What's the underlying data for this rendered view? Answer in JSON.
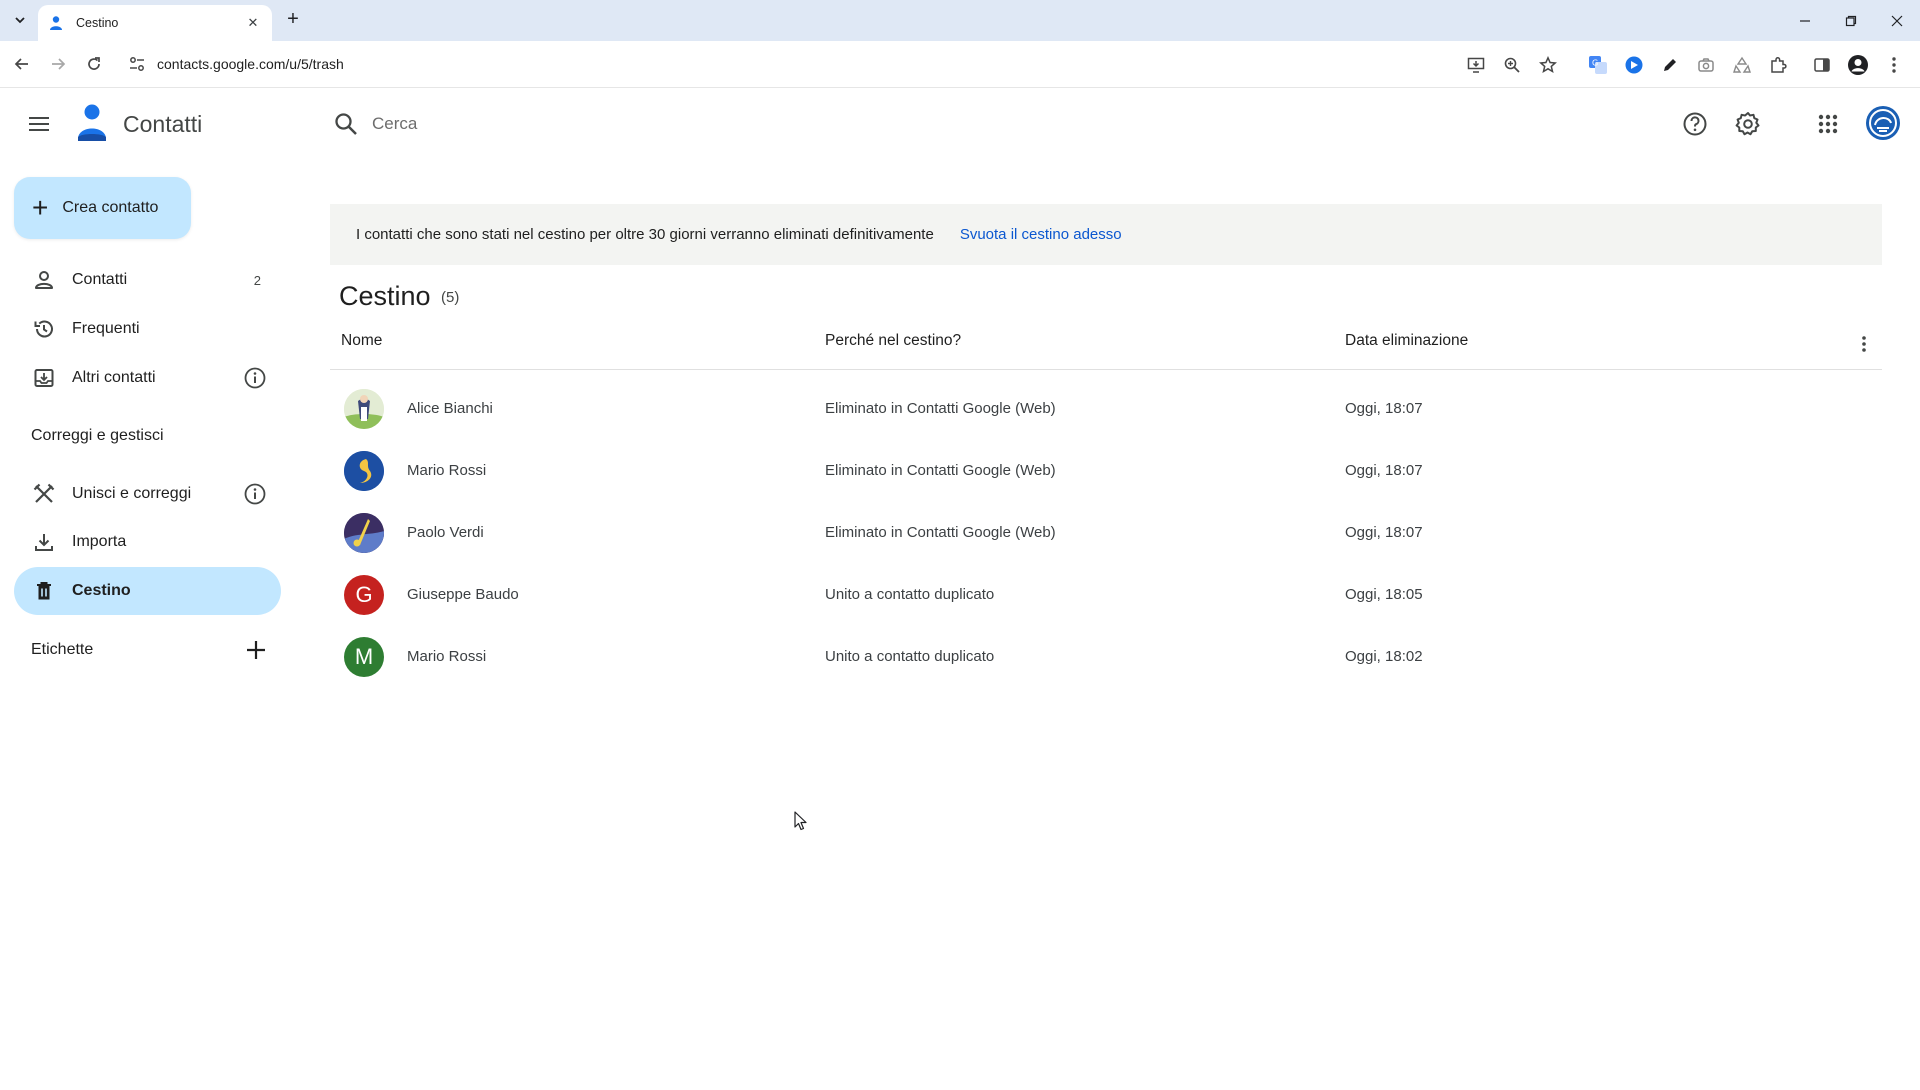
{
  "browser": {
    "tab_title": "Cestino",
    "url": "contacts.google.com/u/5/trash"
  },
  "app": {
    "title": "Contatti",
    "search_placeholder": "Cerca"
  },
  "sidebar": {
    "create_label": "Crea contatto",
    "items": [
      {
        "label": "Contatti",
        "count": "2"
      },
      {
        "label": "Frequenti"
      },
      {
        "label": "Altri contatti"
      }
    ],
    "section_manage": "Correggi e gestisci",
    "manage_items": [
      {
        "label": "Unisci e correggi"
      },
      {
        "label": "Importa"
      },
      {
        "label": "Cestino"
      }
    ],
    "section_labels": "Etichette"
  },
  "banner": {
    "text": "I contatti che sono stati nel cestino per oltre 30 giorni verranno eliminati definitivamente",
    "link": "Svuota il cestino adesso"
  },
  "page": {
    "title": "Cestino",
    "count": "(5)"
  },
  "table": {
    "headers": {
      "name": "Nome",
      "reason": "Perché nel cestino?",
      "date": "Data eliminazione"
    },
    "rows": [
      {
        "name": "Alice Bianchi",
        "reason": "Eliminato in Contatti Google (Web)",
        "date": "Oggi, 18:07",
        "avatar": "photo"
      },
      {
        "name": "Mario Rossi",
        "reason": "Eliminato in Contatti Google (Web)",
        "date": "Oggi, 18:07",
        "avatar": "photo"
      },
      {
        "name": "Paolo Verdi",
        "reason": "Eliminato in Contatti Google (Web)",
        "date": "Oggi, 18:07",
        "avatar": "photo"
      },
      {
        "name": "Giuseppe Baudo",
        "reason": "Unito a contatto duplicato",
        "date": "Oggi, 18:05",
        "avatar_letter": "G",
        "avatar_color": "#c5221f"
      },
      {
        "name": "Mario Rossi",
        "reason": "Unito a contatto duplicato",
        "date": "Oggi, 18:02",
        "avatar_letter": "M",
        "avatar_color": "#2e7d32"
      }
    ]
  },
  "colors": {
    "accent": "#0b57d0",
    "active_bg": "#c2e7ff",
    "banner_bg": "#f3f4f2",
    "tabbar_bg": "#dfe8f5"
  }
}
